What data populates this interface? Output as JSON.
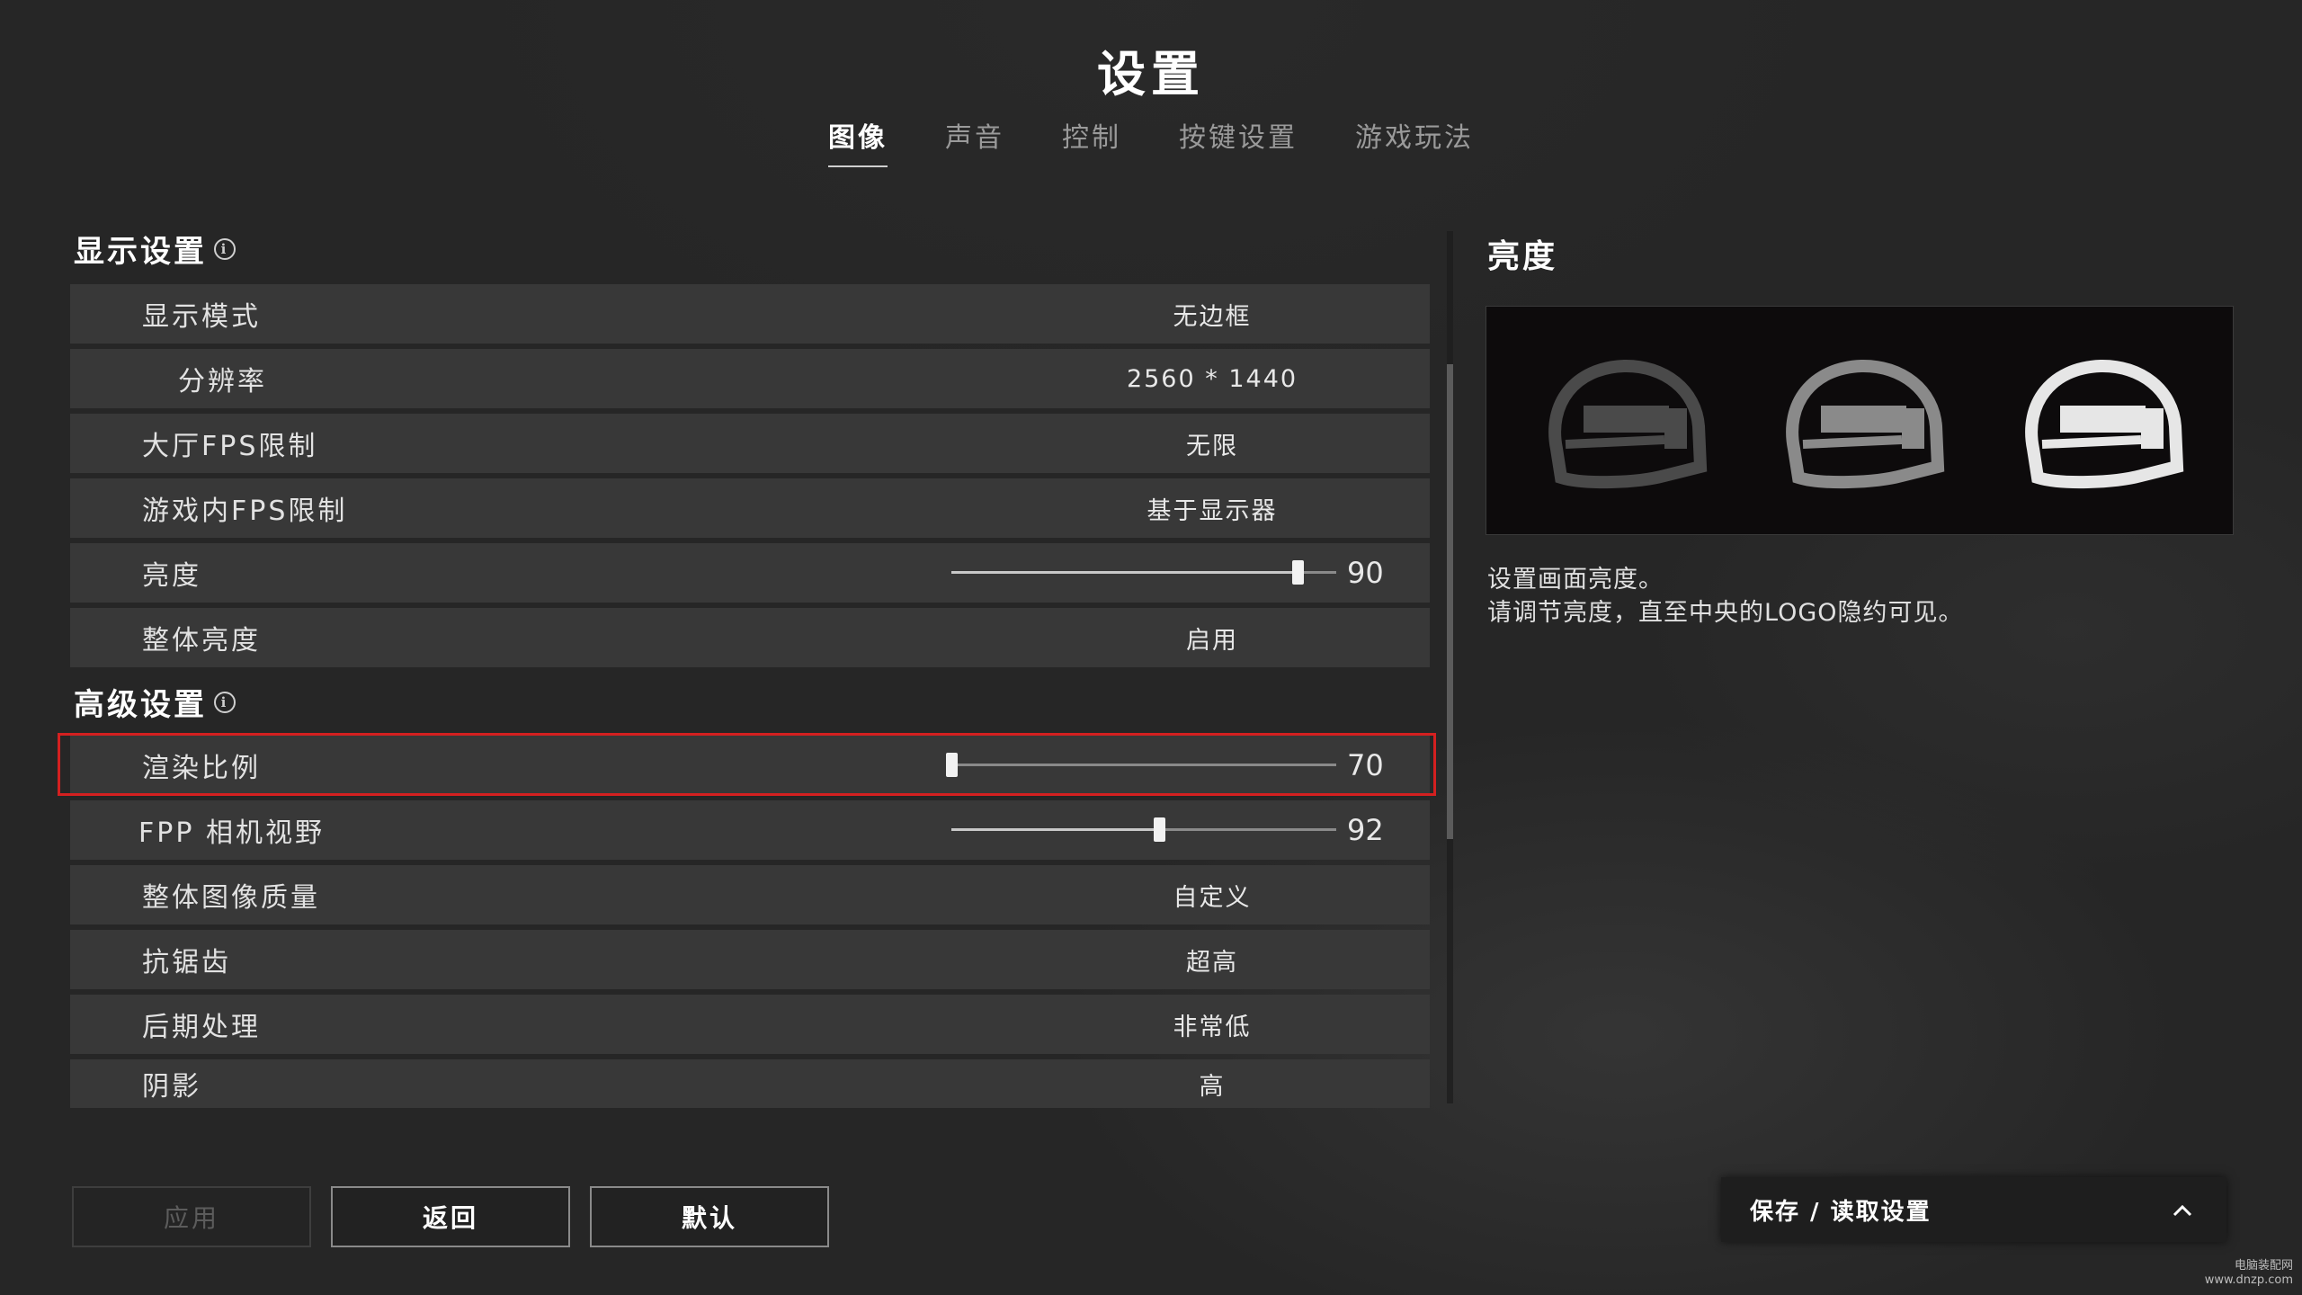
{
  "header": {
    "title": "设置",
    "tabs": [
      {
        "label": "图像",
        "active": true
      },
      {
        "label": "声音",
        "active": false
      },
      {
        "label": "控制",
        "active": false
      },
      {
        "label": "按键设置",
        "active": false
      },
      {
        "label": "游戏玩法",
        "active": false
      }
    ]
  },
  "display_section": {
    "title": "显示设置",
    "rows": [
      {
        "label": "显示模式",
        "value": "无边框"
      },
      {
        "label": "分辨率",
        "value": "2560 * 1440"
      },
      {
        "label": "大厅FPS限制",
        "value": "无限"
      },
      {
        "label": "游戏内FPS限制",
        "value": "基于显示器"
      },
      {
        "label": "亮度",
        "slider_value": "90",
        "slider_fraction": 0.9
      },
      {
        "label": "整体亮度",
        "value": "启用"
      }
    ]
  },
  "advanced_section": {
    "title": "高级设置",
    "rows": [
      {
        "label": "渲染比例",
        "slider_value": "70",
        "slider_fraction": 0.0
      },
      {
        "label": "FPP 相机视野",
        "slider_value": "92",
        "slider_fraction": 0.54
      },
      {
        "label": "整体图像质量",
        "value": "自定义"
      },
      {
        "label": "抗锯齿",
        "value": "超高"
      },
      {
        "label": "后期处理",
        "value": "非常低"
      },
      {
        "label": "阴影",
        "value": "高"
      }
    ]
  },
  "detail_panel": {
    "title": "亮度",
    "description_line1": "设置画面亮度。",
    "description_line2": "请调节亮度，直至中央的LOGO隐约可见。"
  },
  "footer": {
    "apply_label": "应用",
    "back_label": "返回",
    "default_label": "默认",
    "save_load_label": "保存 / 读取设置"
  },
  "watermark": {
    "line1": "电脑装配网",
    "line2": "www.dnzp.com"
  },
  "colors": {
    "highlight": "#d42020",
    "row_bg": "#3a3a3a",
    "background": "#262626"
  }
}
